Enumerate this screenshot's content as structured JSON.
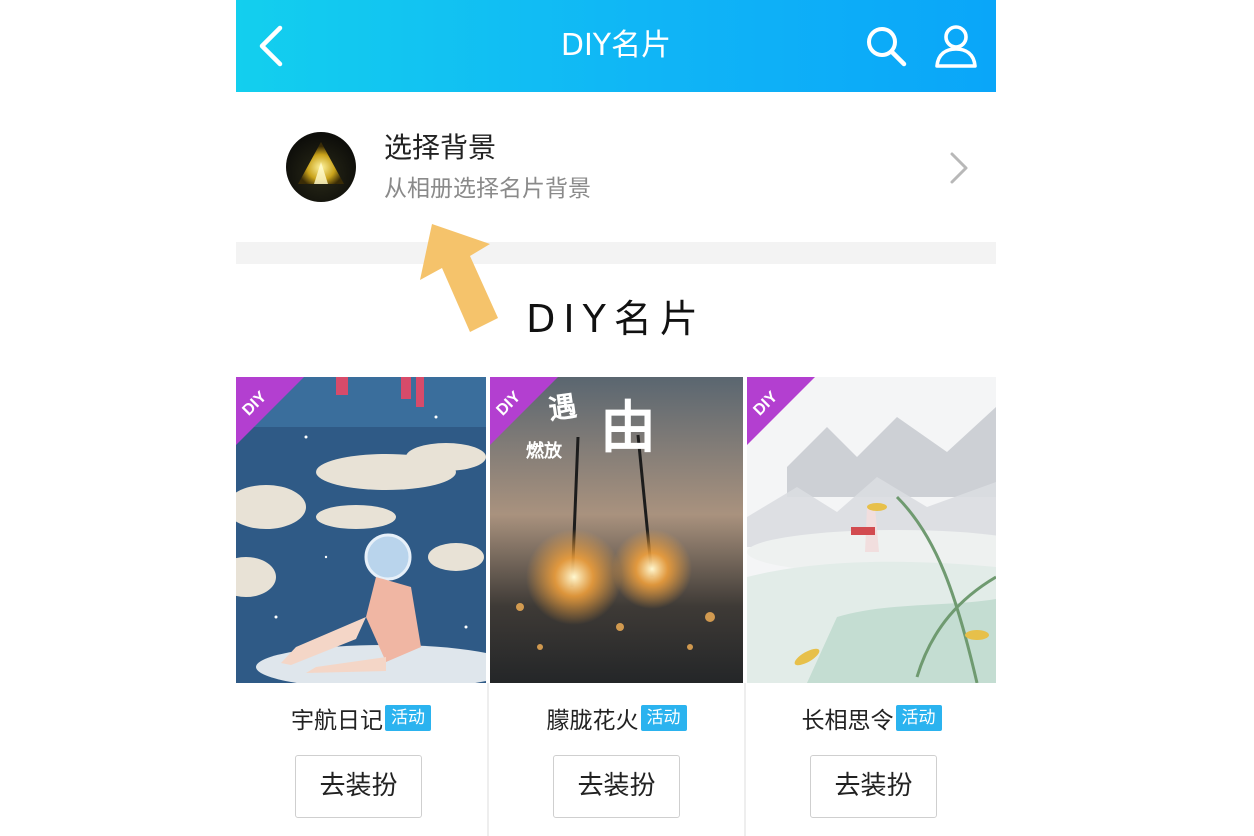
{
  "header": {
    "title": "DIY名片",
    "back_icon": "chevron-left-icon",
    "search_icon": "search-icon",
    "user_icon": "user-icon",
    "gradient_colors": [
      "#13cfee",
      "#0aa6f9"
    ]
  },
  "background_picker": {
    "title": "选择背景",
    "subtitle": "从相册选择名片背景"
  },
  "section_title": "DIY名片",
  "cards": [
    {
      "name": "宇航日记",
      "tag": "活动",
      "button": "去装扮",
      "badge": "DIY"
    },
    {
      "name": "朦胧花火",
      "tag": "活动",
      "button": "去装扮",
      "badge": "DIY"
    },
    {
      "name": "长相思令",
      "tag": "活动",
      "button": "去装扮",
      "badge": "DIY"
    }
  ],
  "colors": {
    "tag_bg": "#2bb3ef",
    "badge_bg": "#b33fd0",
    "annotation_arrow": "#f5c36b"
  }
}
